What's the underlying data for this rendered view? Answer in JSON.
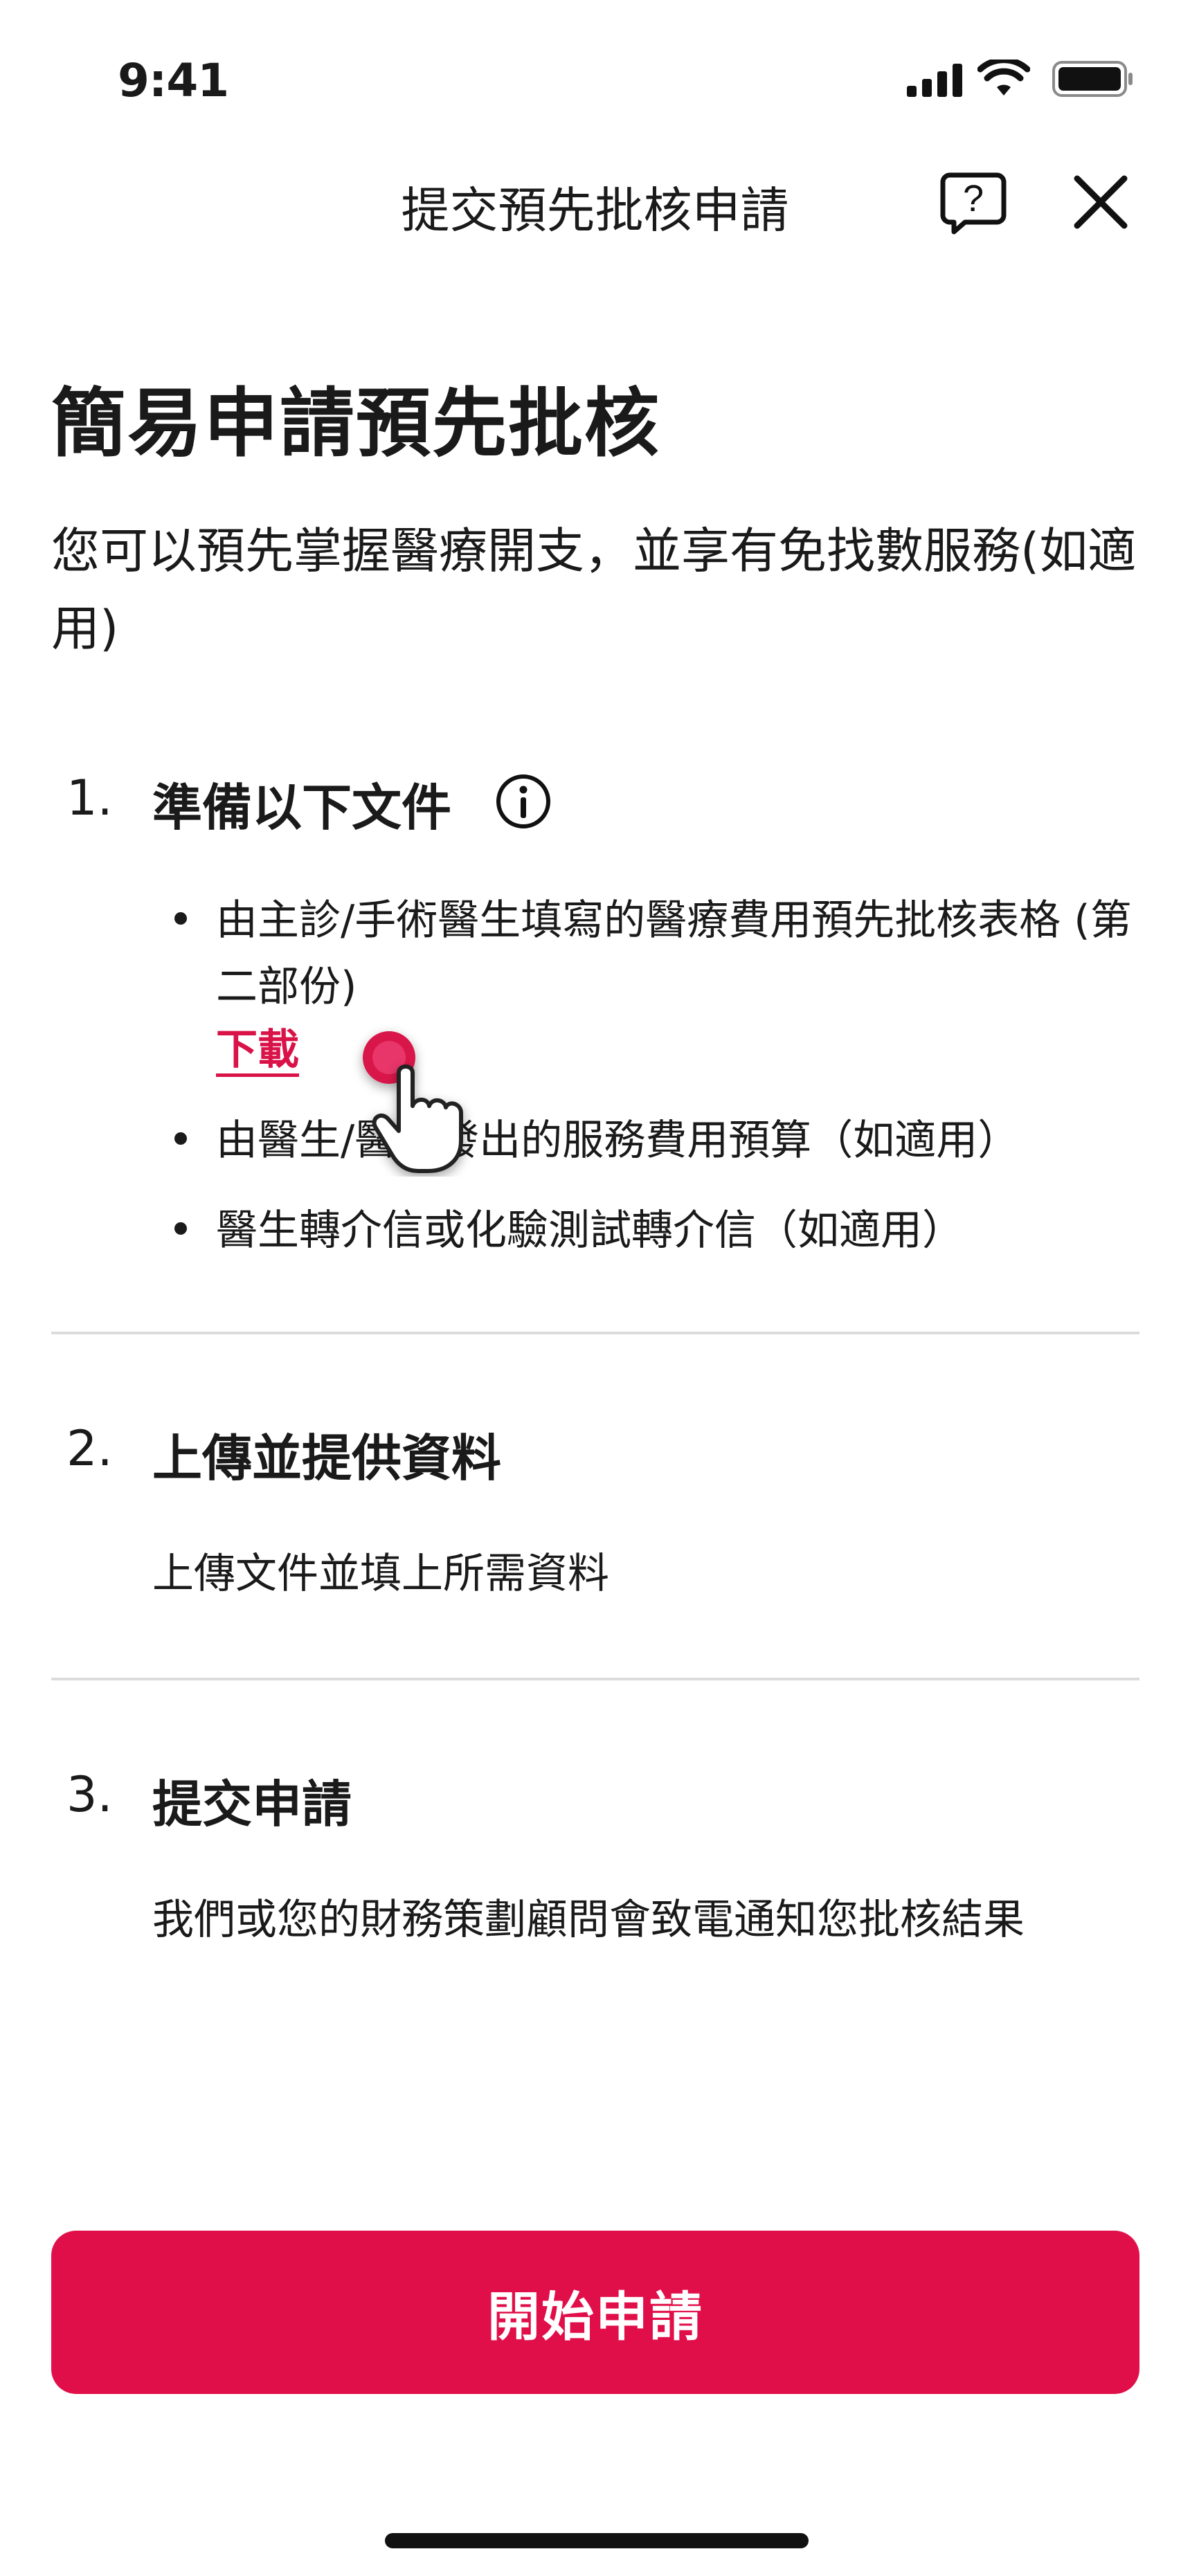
{
  "status_bar": {
    "time": "9:41"
  },
  "header": {
    "title": "提交預先批核申請",
    "help_icon": "help-icon",
    "close_icon": "close-icon"
  },
  "hero": {
    "title": "簡易申請預先批核",
    "description": "您可以預先掌握醫療開支，並享有免找數服務(如適用)"
  },
  "steps": [
    {
      "number": "1.",
      "title": "準備以下文件",
      "info_icon": "info-icon",
      "bullets": [
        "由主診/手術醫生填寫的醫療費用預先批核表格 (第二部份)",
        "由醫生/醫院發出的服務費用預算（如適用）",
        "醫生轉介信或化驗測試轉介信（如適用）"
      ],
      "download_label": "下載"
    },
    {
      "number": "2.",
      "title": "上傳並提供資料",
      "description": "上傳文件並填上所需資料"
    },
    {
      "number": "3.",
      "title": "提交申請",
      "description": "我們或您的財務策劃顧問會致電通知您批核結果"
    }
  ],
  "primary_button": {
    "label": "開始申請"
  },
  "colors": {
    "accent": "#e10f49",
    "link": "#d91248",
    "text": "#1a1a1a",
    "divider": "#dcdcdc"
  }
}
